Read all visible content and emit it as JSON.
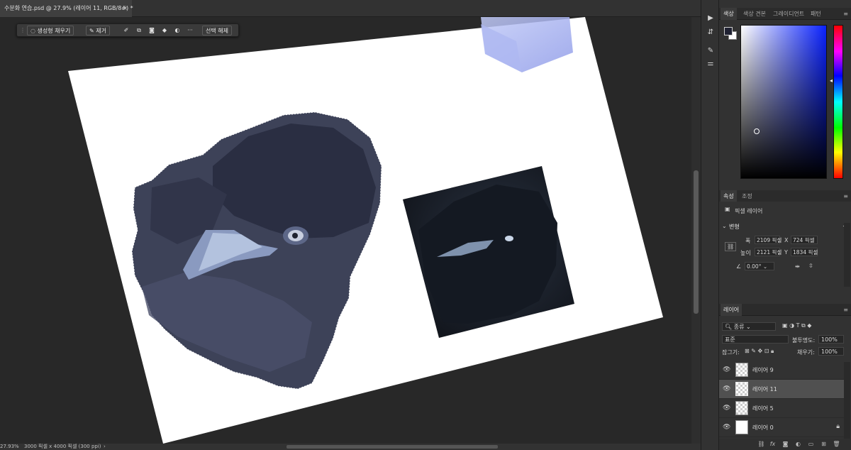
{
  "document": {
    "tab_title": "수분화 연습.psd @ 27.9% (레이어 11, RGB/8#) *",
    "close_glyph": "×"
  },
  "contextual_taskbar": {
    "generative_fill_label": "생성형 채우기",
    "remove_label": "제거",
    "more_glyph": "···",
    "deselect_label": "선택 해제"
  },
  "status_bar": {
    "zoom": "27.93%",
    "doc_info": "3000 픽셀 x 4000 픽셀 (300 ppi)",
    "arrow": "›"
  },
  "color_panel": {
    "tabs": [
      "색상",
      "색상 견본",
      "그레이디언트",
      "패턴"
    ],
    "active_tab": 0,
    "foreground_color": "#202233",
    "background_color": "#ffffff",
    "hue_color": "#0a22ff"
  },
  "properties_panel": {
    "tabs": [
      "속성",
      "조정"
    ],
    "active_tab": 0,
    "layer_type": "픽셀 레이어",
    "section_title": "변형",
    "width_label": "폭",
    "width_value": "2109 픽셀",
    "height_label": "높이",
    "height_value": "2121 픽셀",
    "x_label": "X",
    "x_value": "724 픽셀",
    "y_label": "Y",
    "y_value": "1834 픽셀",
    "angle_value": "0.00°"
  },
  "layers_panel": {
    "tab": "레이어",
    "filter_kind": "종류",
    "blend_mode": "표준",
    "opacity_label": "불투명도:",
    "opacity_value": "100%",
    "lock_label": "잠그기:",
    "fill_label": "채우기:",
    "fill_value": "100%",
    "layers": [
      {
        "name": "레이어 9",
        "visible": true,
        "selected": false,
        "locked": false
      },
      {
        "name": "레이어 11",
        "visible": true,
        "selected": true,
        "locked": false
      },
      {
        "name": "레이어 5",
        "visible": true,
        "selected": false,
        "locked": false
      },
      {
        "name": "레이어 0",
        "visible": true,
        "selected": false,
        "locked": true
      }
    ],
    "footer_fx": "fx"
  }
}
